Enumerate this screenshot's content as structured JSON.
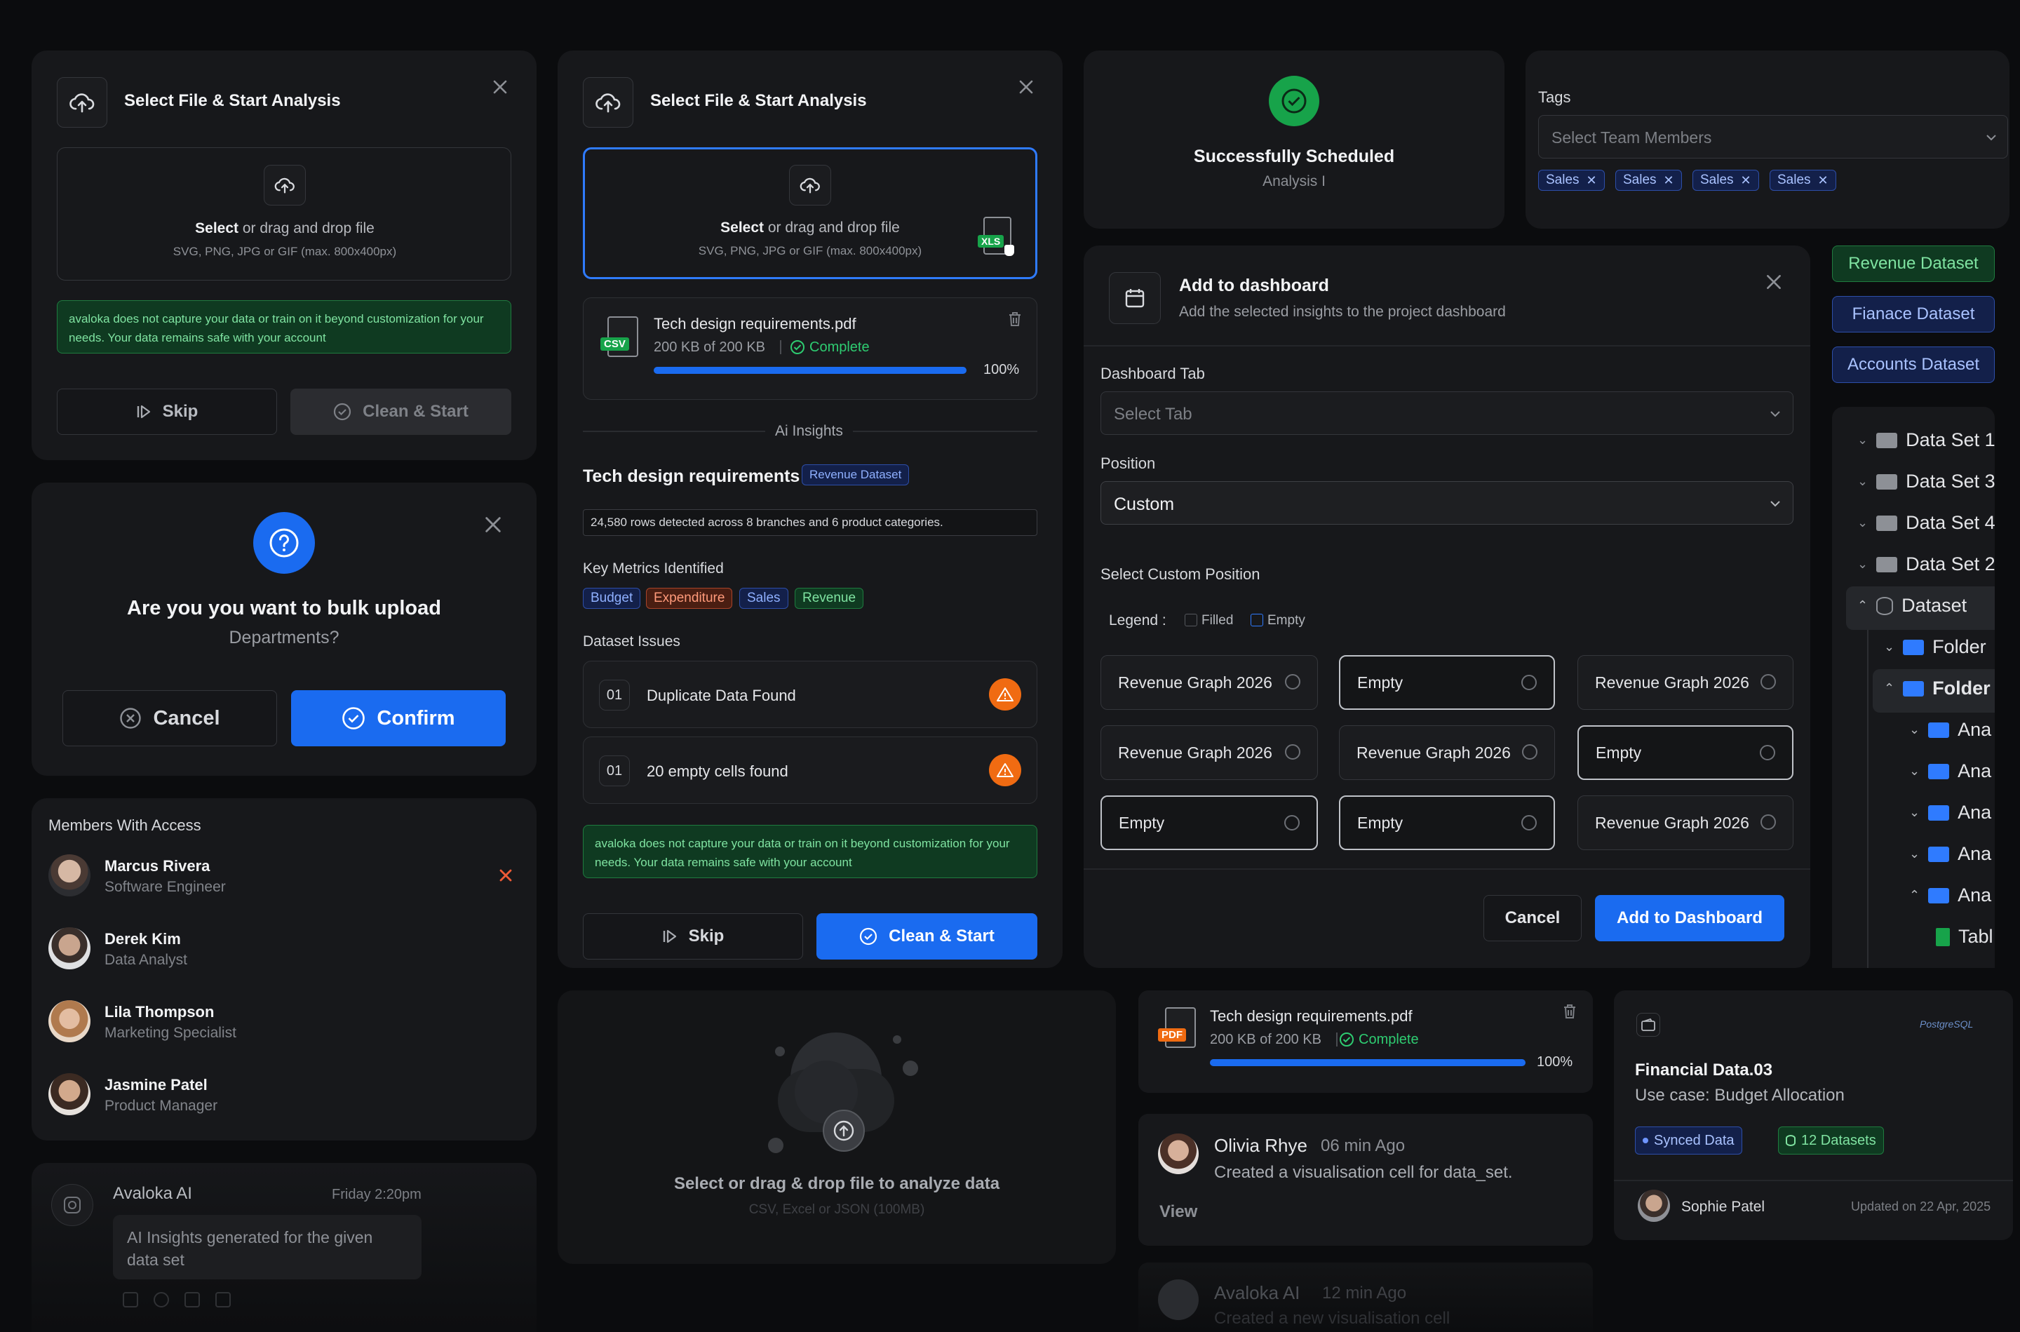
{
  "upload_a": {
    "title": "Select File & Start Analysis",
    "select": "Select",
    "drag": " or drag and drop file",
    "formats": "SVG, PNG, JPG or GIF (max. 800x400px)",
    "notice": "avaloka does not capture your data or train on it beyond customization for your needs. Your data remains safe with your account",
    "skip": "Skip",
    "clean": "Clean & Start"
  },
  "confirm": {
    "title": "Are you you want to bulk upload",
    "subtitle": "Departments?",
    "cancel": "Cancel",
    "confirm": "Confirm"
  },
  "members": {
    "heading": "Members With Access",
    "items": [
      {
        "name": "Marcus Rivera",
        "role": "Software Engineer"
      },
      {
        "name": "Derek Kim",
        "role": "Data Analyst"
      },
      {
        "name": "Lila Thompson",
        "role": "Marketing Specialist"
      },
      {
        "name": "Jasmine Patel",
        "role": "Product Manager"
      }
    ]
  },
  "ai_msg": {
    "sender": "Avaloka AI",
    "time": "Friday 2:20pm",
    "text1": "AI Insights generated for the given",
    "text2": "data set"
  },
  "upload_b": {
    "title": "Select File & Start Analysis",
    "select": "Select",
    "drag": " or drag and drop file",
    "formats": "SVG, PNG, JPG or GIF (max. 800x400px)",
    "badge": "XLS",
    "file_badge": "CSV",
    "file": "Tech design requirements.pdf",
    "size": "200 KB of 200 KB",
    "status": "Complete",
    "percent": "100%",
    "progress": 1.0,
    "divider": "Ai Insights",
    "heading": "Tech design requirements",
    "dataset_tag": "Revenue Dataset",
    "summary": "24,580 rows detected across 8 branches and 6 product categories.",
    "metrics_label": "Key Metrics Identified",
    "metrics": [
      "Budget",
      "Expenditure",
      "Sales",
      "Revenue"
    ],
    "issues_label": "Dataset Issues",
    "issues": [
      {
        "num": "01",
        "text": "Duplicate Data Found"
      },
      {
        "num": "01",
        "text": "20 empty cells found"
      }
    ],
    "notice": "avaloka does not capture your data or train on it beyond customization for your needs. Your data remains safe with your account",
    "skip": "Skip",
    "clean": "Clean & Start"
  },
  "dropzone": {
    "title": "Select or drag & drop file to analyze data",
    "sub": "CSV, Excel or JSON (100MB)"
  },
  "success": {
    "title": "Successfully Scheduled",
    "sub": "Analysis I"
  },
  "tags": {
    "label": "Tags",
    "placeholder": "Select Team Members",
    "chips": [
      "Sales",
      "Sales",
      "Sales",
      "Sales"
    ]
  },
  "dashboard": {
    "title": "Add to dashboard",
    "sub": "Add the selected insights to the project dashboard",
    "tab_label": "Dashboard Tab",
    "tab_placeholder": "Select Tab",
    "pos_label": "Position",
    "pos_value": "Custom",
    "custom_label": "Select Custom Position",
    "legend": "Legend :",
    "filled": "Filled",
    "empty": "Empty",
    "cells": [
      "Revenue Graph 2026",
      "Empty",
      "Revenue Graph 2026",
      "Revenue Graph 2026",
      "Revenue Graph 2026",
      "Empty",
      "Empty",
      "Empty",
      "Revenue Graph 2026"
    ],
    "cancel": "Cancel",
    "add": "Add to Dashboard"
  },
  "datasets": {
    "buttons": [
      "Revenue Dataset",
      "Fianace Dataset",
      "Accounts Dataset"
    ],
    "tree": [
      "Data Set 1",
      "Data Set 3",
      "Data Set 4",
      "Data Set 2",
      "Dataset",
      "Folder",
      "Folder",
      "Ana",
      "Ana",
      "Ana",
      "Ana",
      "Ana",
      "Tabl"
    ]
  },
  "file_pdf": {
    "badge": "PDF",
    "name": "Tech design requirements.pdf",
    "size": "200 KB of 200 KB",
    "status": "Complete",
    "percent": "100%",
    "progress": 1.0
  },
  "activity": {
    "name": "Olivia Rhye",
    "time": "06 min Ago",
    "text": "Created a visualisation cell for data_set.",
    "link": "View",
    "name2": "Avaloka AI",
    "time2": "12 min Ago",
    "text2": "Created a new visualisation cell"
  },
  "financial": {
    "brand": "PostgreSQL",
    "title": "Financial Data.03",
    "use_case": "Use case: Budget Allocation",
    "synced": "Synced Data",
    "datasets": "12 Datasets",
    "user": "Sophie Patel",
    "updated": "Updated on 22 Apr, 2025"
  },
  "colors": {
    "accent": "#1a6bf0",
    "success": "#17a34a",
    "warning": "#f06b12",
    "danger": "#ef5a36"
  }
}
